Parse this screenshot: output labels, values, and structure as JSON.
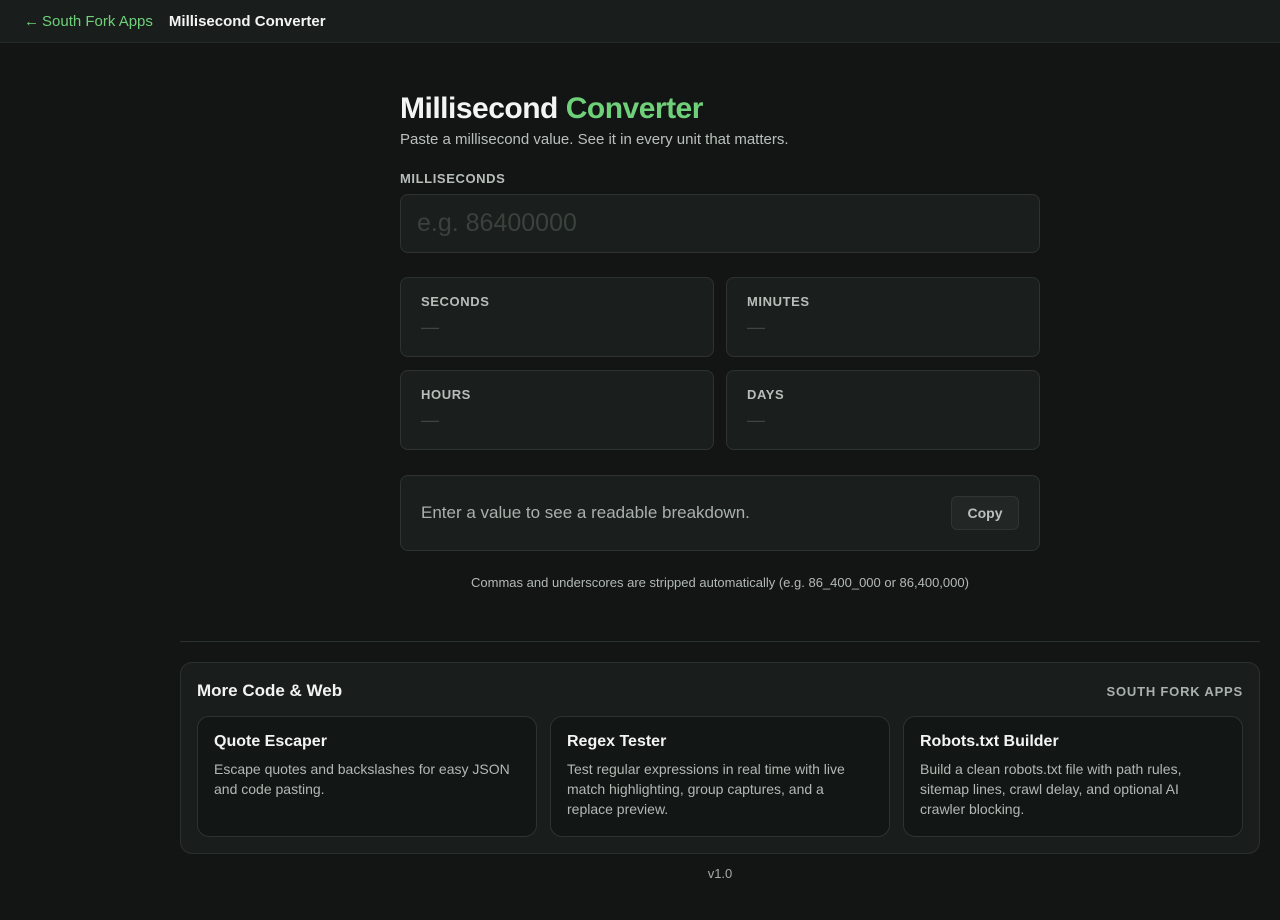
{
  "topbar": {
    "back_arrow": "←",
    "back_label": "South Fork Apps",
    "title": "Millisecond Converter"
  },
  "page": {
    "heading_main": "Millisecond",
    "heading_accent": "Converter",
    "subtitle": "Paste a millisecond value. See it in every unit that matters.",
    "input_label": "MILLISECONDS",
    "input_placeholder": "e.g. 86400000",
    "input_value": ""
  },
  "units": [
    {
      "label": "SECONDS",
      "value": "—"
    },
    {
      "label": "MINUTES",
      "value": "—"
    },
    {
      "label": "HOURS",
      "value": "—"
    },
    {
      "label": "DAYS",
      "value": "—"
    }
  ],
  "breakdown": {
    "text": "Enter a value to see a readable breakdown.",
    "copy_label": "Copy"
  },
  "hint": "Commas and underscores are stripped automatically (e.g. 86_400_000 or 86,400,000)",
  "more": {
    "title": "More Code & Web",
    "brand": "SOUTH FORK APPS",
    "tools": [
      {
        "name": "Quote Escaper",
        "desc": "Escape quotes and backslashes for easy JSON and code pasting."
      },
      {
        "name": "Regex Tester",
        "desc": "Test regular expressions in real time with live match highlighting, group captures, and a replace preview."
      },
      {
        "name": "Robots.txt Builder",
        "desc": "Build a clean robots.txt file with path rules, sitemap lines, crawl delay, and optional AI crawler blocking."
      }
    ]
  },
  "version": "v1.0",
  "colors": {
    "accent": "#6fd07a",
    "background": "#121514",
    "surface": "#1a1e1c"
  }
}
